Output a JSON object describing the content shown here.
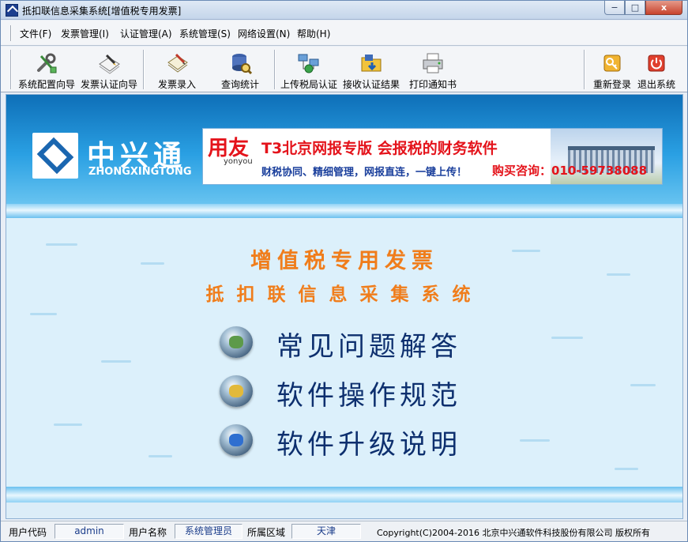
{
  "window": {
    "title": "抵扣联信息采集系统[增值税专用发票]",
    "controls": {
      "minimize": "−",
      "maximize": "□",
      "close": "x"
    }
  },
  "menu": [
    {
      "label": "文件(F)"
    },
    {
      "label": "发票管理(I)"
    },
    {
      "label": "认证管理(A)"
    },
    {
      "label": "系统管理(S)"
    },
    {
      "label": "网络设置(N)"
    },
    {
      "label": "帮助(H)"
    }
  ],
  "toolbar": [
    {
      "label": "系统配置向导",
      "icon": "wrench-tools-icon"
    },
    {
      "label": "发票认证向导",
      "icon": "documents-pen-icon"
    },
    {
      "label": "发票录入",
      "icon": "notebook-pen-icon"
    },
    {
      "label": "查询统计",
      "icon": "database-search-icon"
    },
    {
      "label": "上传税局认证",
      "icon": "network-upload-icon"
    },
    {
      "label": "接收认证结果",
      "icon": "folder-receive-icon"
    },
    {
      "label": "打印通知书",
      "icon": "printer-icon"
    },
    {
      "label": "重新登录",
      "icon": "key-icon"
    },
    {
      "label": "退出系统",
      "icon": "power-exit-icon"
    }
  ],
  "banner": {
    "brand_cn": "中兴通",
    "brand_en": "ZHONGXINGTONG",
    "ad": {
      "brand": "用友",
      "brand_sub": "yonyou",
      "title": "T3北京网报专版    会报税的财务软件",
      "subtitle": "财税协同、精细管理，网报直连，一键上传！",
      "phone": "购买咨询：010-59738088"
    }
  },
  "headings": {
    "line1": "增值税专用发票",
    "line2": "抵扣联信息采集系统"
  },
  "links": [
    {
      "label": "常见问题解答",
      "icon": "faq-orb-icon"
    },
    {
      "label": "软件操作规范",
      "icon": "guide-orb-icon"
    },
    {
      "label": "软件升级说明",
      "icon": "upgrade-orb-icon"
    }
  ],
  "status": {
    "user_code_label": "用户代码",
    "user_code": "admin",
    "user_name_label": "用户名称",
    "user_name": "系统管理员",
    "region_label": "所属区域",
    "region": "天津",
    "copyright": "Copyright(C)2004-2016 北京中兴通软件科技股份有限公司 版权所有"
  },
  "colors": {
    "heading": "#f07d1b",
    "link_text": "#0d2f6e",
    "banner_blue": "#1a8ad6",
    "ad_red": "#e4131b"
  }
}
